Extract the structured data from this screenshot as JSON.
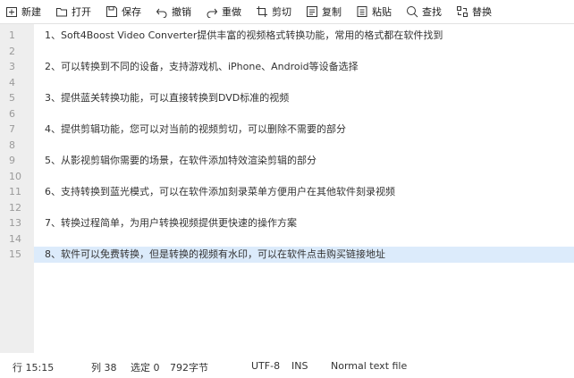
{
  "toolbar": {
    "new": "新建",
    "open": "打开",
    "save": "保存",
    "undo": "撤销",
    "redo": "重做",
    "cut": "剪切",
    "copy": "复制",
    "paste": "粘贴",
    "find": "查找",
    "replace": "替换"
  },
  "editor": {
    "lines": [
      {
        "num": "1",
        "text": "1、Soft4Boost Video Converter提供丰富的视频格式转换功能，常用的格式都在软件找到"
      },
      {
        "num": "2",
        "text": ""
      },
      {
        "num": "3",
        "text": "2、可以转换到不同的设备，支持游戏机、iPhone、Android等设备选择"
      },
      {
        "num": "4",
        "text": ""
      },
      {
        "num": "5",
        "text": "3、提供蓝关转换功能，可以直接转换到DVD标准的视频"
      },
      {
        "num": "6",
        "text": ""
      },
      {
        "num": "7",
        "text": "4、提供剪辑功能，您可以对当前的视频剪切，可以删除不需要的部分"
      },
      {
        "num": "8",
        "text": ""
      },
      {
        "num": "9",
        "text": "5、从影视剪辑你需要的场景，在软件添加特效渲染剪辑的部分"
      },
      {
        "num": "10",
        "text": ""
      },
      {
        "num": "11",
        "text": "6、支持转换到蓝光模式，可以在软件添加刻录菜单方便用户在其他软件刻录视频"
      },
      {
        "num": "12",
        "text": ""
      },
      {
        "num": "13",
        "text": "7、转换过程简单，为用户转换视频提供更快速的操作方案"
      },
      {
        "num": "14",
        "text": ""
      },
      {
        "num": "15",
        "text": "8、软件可以免费转换，但是转换的视频有水印，可以在软件点击购买链接地址"
      }
    ],
    "active_line": 15,
    "highlight_color": "#dcebfb"
  },
  "status": {
    "row": "行 15:15",
    "col": "列 38",
    "selection": "选定 0",
    "bytes": "792字节",
    "encoding": "UTF-8",
    "mode": "INS",
    "filetype": "Normal text file"
  }
}
